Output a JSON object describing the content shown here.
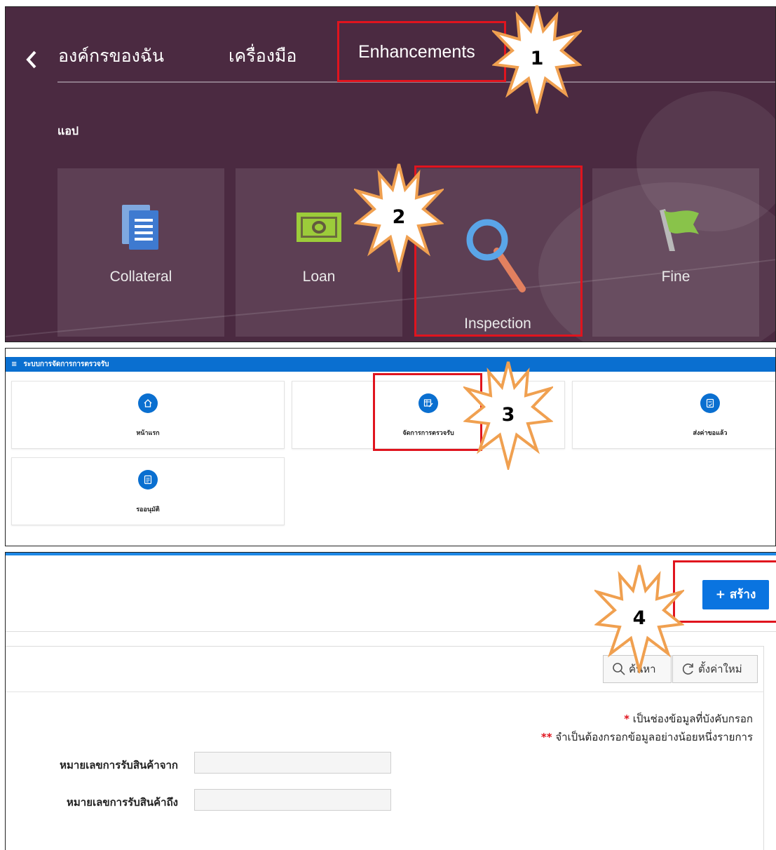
{
  "springboard": {
    "back_icon": "chevron-left-icon",
    "tabs": [
      {
        "label": "องค์กรของฉัน"
      },
      {
        "label": "เครื่องมือ"
      },
      {
        "label": "Enhancements"
      }
    ],
    "section_label": "แอป",
    "apps": [
      {
        "label": "Collateral",
        "icon": "document-stack-icon"
      },
      {
        "label": "Loan",
        "icon": "banknote-icon"
      },
      {
        "label": "Inspection",
        "icon": "magnifier-icon"
      },
      {
        "label": "Fine",
        "icon": "flag-icon"
      }
    ],
    "colors": {
      "background": "#4b2a41",
      "highlight": "#e0141e"
    }
  },
  "step_badges": [
    {
      "number": "1"
    },
    {
      "number": "2"
    },
    {
      "number": "3"
    },
    {
      "number": "4"
    }
  ],
  "menu": {
    "header": "ระบบการจัดการการตรวจรับ",
    "menu_icon": "hamburger-icon",
    "cards": [
      {
        "label": "หน้าแรก",
        "icon": "home-icon"
      },
      {
        "label": "จัดการการตรวจรับ",
        "icon": "table-edit-icon"
      },
      {
        "label": "ส่งค่าขอแล้ว",
        "icon": "document-check-icon"
      },
      {
        "label": "รออนุมัติ",
        "icon": "document-list-icon"
      }
    ],
    "accent": "#0a6fd0"
  },
  "form": {
    "create_label": "+ สร้าง",
    "search_label": "ค้นหา",
    "reset_label": "ตั้งค่าใหม่",
    "required_note_marker": "*",
    "required_note": " เป็นช่องข้อมูลที่บังคับกรอก",
    "optional_note_marker": "**",
    "optional_note": " จำเป็นต้องกรอกข้อมูลอย่างน้อยหนึ่งรายการ",
    "fields": [
      {
        "label": "หมายเลขการรับสินค้าจาก",
        "value": ""
      },
      {
        "label": "หมายเลขการรับสินค้าถึง",
        "value": ""
      }
    ]
  }
}
